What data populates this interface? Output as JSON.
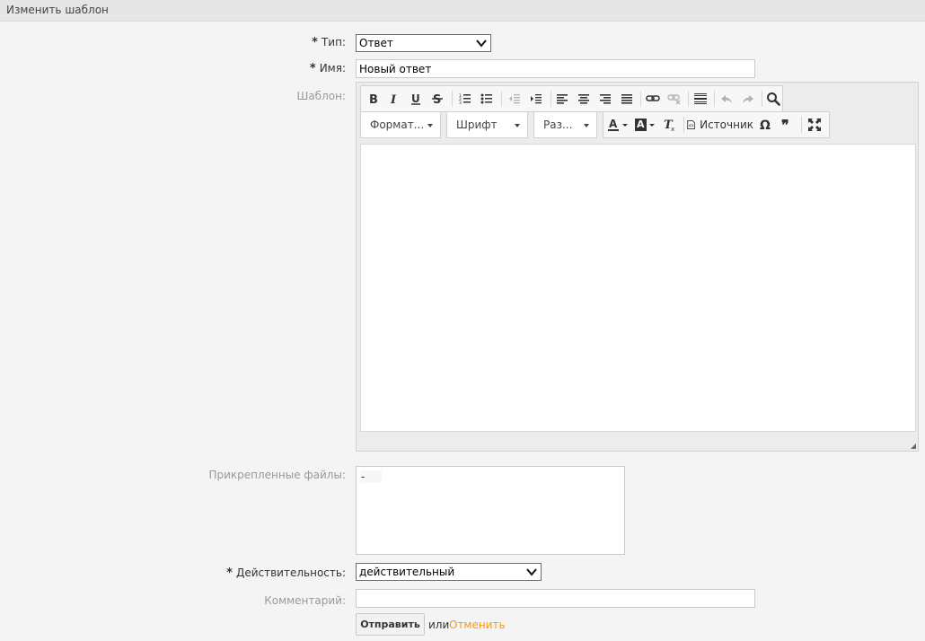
{
  "header": {
    "title": "Изменить шаблон"
  },
  "form": {
    "type": {
      "label": "Тип:",
      "value": "Ответ",
      "required_mark": "*"
    },
    "name": {
      "label": "Имя:",
      "value": "Новый ответ",
      "required_mark": "*"
    },
    "template": {
      "label": "Шаблон:"
    },
    "attachments": {
      "label": "Прикрепленные файлы:",
      "items": [
        "-"
      ]
    },
    "validity": {
      "label": "Действительность:",
      "value": "действительный",
      "required_mark": "*"
    },
    "comment": {
      "label": "Комментарий:",
      "value": ""
    }
  },
  "editor": {
    "toolbar_row1_icons": [
      "bold",
      "italic",
      "underline",
      "strikethrough",
      "numbered-list",
      "bulleted-list",
      "outdent",
      "indent",
      "align-left",
      "align-center",
      "align-right",
      "justify",
      "link",
      "unlink",
      "horizontal-rule",
      "undo",
      "redo",
      "find"
    ],
    "format_label": "Формат...",
    "font_label": "Шрифт",
    "size_label": "Раз...",
    "source_label": "Источник",
    "row2_icons": [
      "text-color",
      "background-color",
      "remove-format",
      "source",
      "special-char",
      "blockquote",
      "maximize"
    ]
  },
  "actions": {
    "submit_label": "Отправить",
    "or_label": "или",
    "cancel_label": "Отменить"
  },
  "colors": {
    "accent": "#f39c12"
  }
}
